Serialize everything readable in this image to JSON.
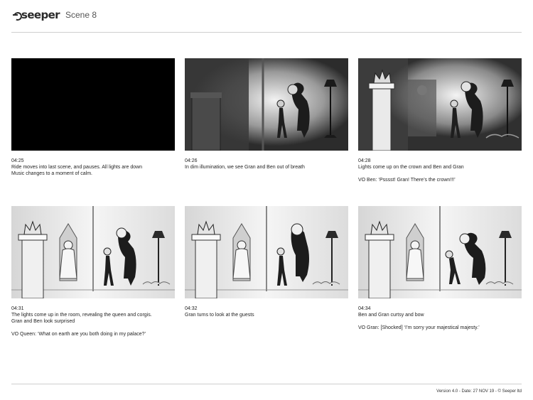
{
  "header": {
    "logo_text": "seeper",
    "scene_title": "Scene 8"
  },
  "panels": [
    {
      "time": "04:25",
      "lines": [
        "Ride moves into last scene, and pauses. All lights are down",
        "Music changes to a moment of calm."
      ],
      "vo": ""
    },
    {
      "time": "04:26",
      "lines": [
        "In dim illumination, we see Gran and Ben out of breath"
      ],
      "vo": ""
    },
    {
      "time": "04:28",
      "lines": [
        "Lights come up on the crown and Ben and Gran"
      ],
      "vo": "VO Ben: ‘Psssst! Gran! There’s the crown!!!’"
    },
    {
      "time": "04:31",
      "lines": [
        "The lights come up in the room, revealing the queen and corgis.",
        "Gran and Ben look surprised"
      ],
      "vo": "VO Queen: ‘What on earth are you both doing in my palace?’"
    },
    {
      "time": "04:32",
      "lines": [
        "Gran turns to look at the guests"
      ],
      "vo": ""
    },
    {
      "time": "04:34",
      "lines": [
        "Ben and Gran curtsy and bow"
      ],
      "vo": "VO Gran: [Shocked] ‘I’m sorry your majestical majesty.’"
    }
  ],
  "footer": {
    "text": "Version 4.0 - Date: 27 NOV 19 - © Seeper ltd"
  }
}
